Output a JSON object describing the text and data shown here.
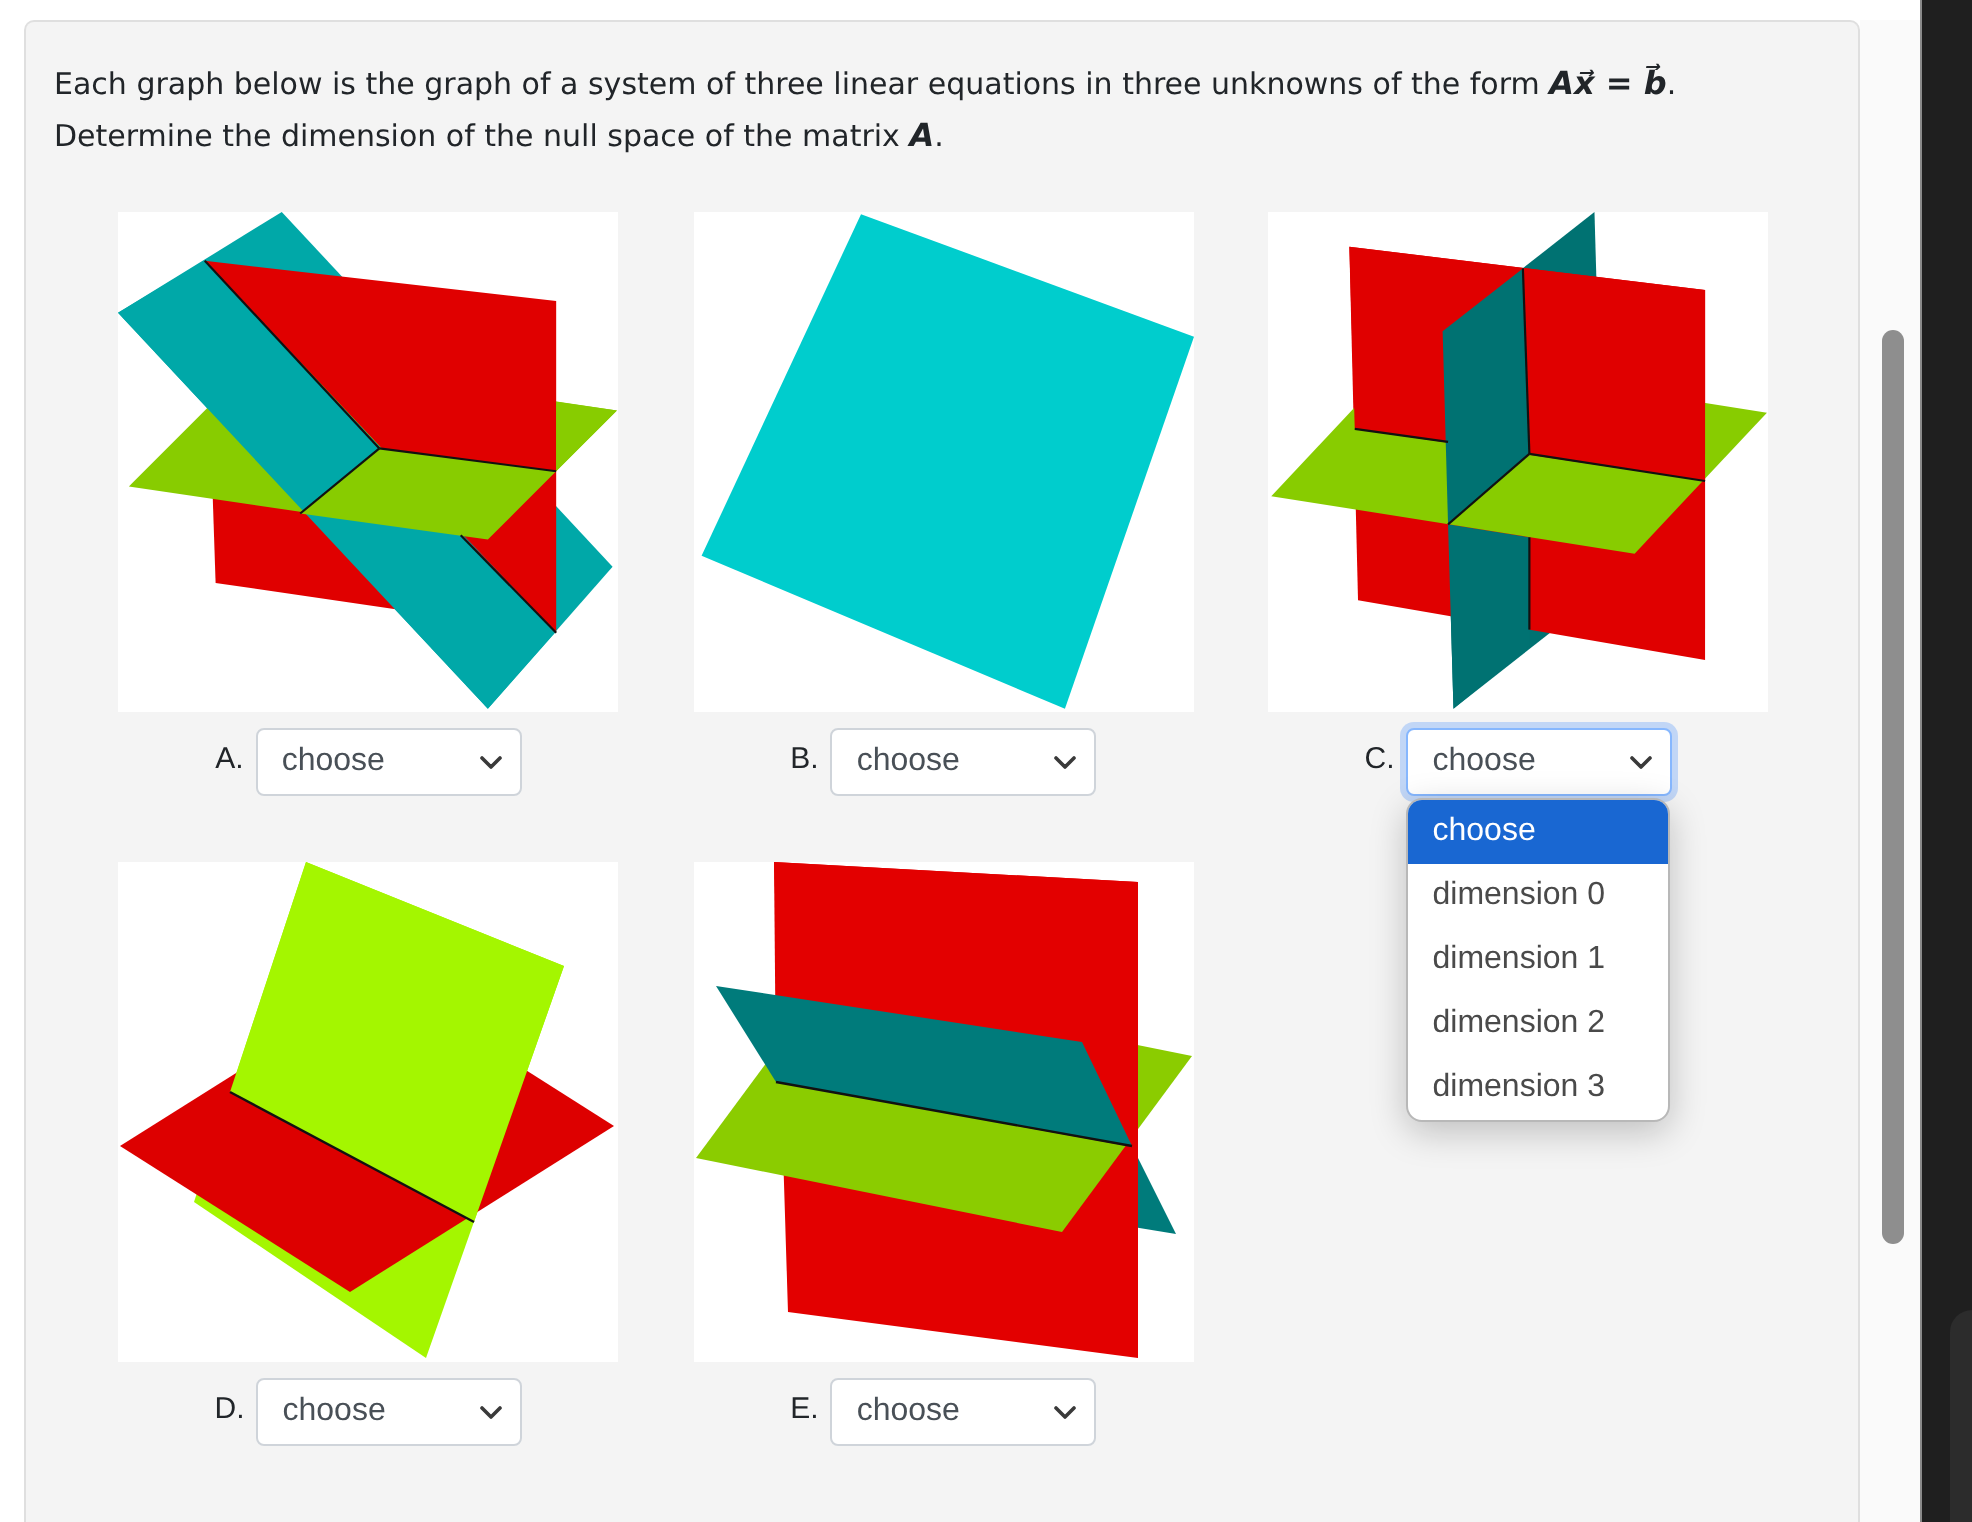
{
  "instructions": [
    "Each graph below is the graph of a system of three linear equations in three unknowns of the form *Ax⃗ = b⃗*.",
    "Determine the dimension of the null space of the matrix *A*."
  ],
  "graphs": [
    {
      "kind": "slanted",
      "label": "A.",
      "select": {
        "value": "choose",
        "focused": false,
        "expanded": false
      }
    },
    {
      "kind": "single",
      "label": "B.",
      "select": {
        "value": "choose",
        "focused": false,
        "expanded": false
      }
    },
    {
      "kind": "orthogonal",
      "label": "C.",
      "select": {
        "value": "choose",
        "focused": true,
        "expanded": true,
        "options": [
          {
            "label": "choose",
            "selected": true
          },
          {
            "label": "dimension 0",
            "selected": false
          },
          {
            "label": "dimension 1",
            "selected": false
          },
          {
            "label": "dimension 2",
            "selected": false
          },
          {
            "label": "dimension 3",
            "selected": false
          }
        ]
      }
    },
    {
      "kind": "pair",
      "label": "D.",
      "select": {
        "value": "choose",
        "focused": false,
        "expanded": false
      }
    },
    {
      "kind": "sheaf",
      "label": "E.",
      "select": {
        "value": "choose",
        "focused": false,
        "expanded": false
      }
    }
  ]
}
